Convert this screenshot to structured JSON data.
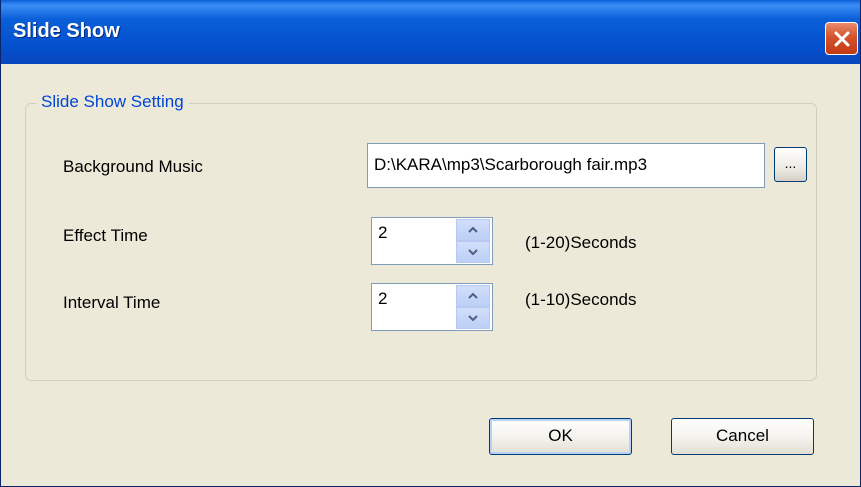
{
  "window": {
    "title": "Slide Show",
    "titlebar_color": "#0a5fd8",
    "close_icon": "close-icon"
  },
  "group": {
    "legend": "Slide Show Setting"
  },
  "background_music": {
    "label": "Background Music",
    "value": "D:\\KARA\\mp3\\Scarborough fair.mp3",
    "browse_label": "..."
  },
  "effect_time": {
    "label": "Effect Time",
    "value": "2",
    "range_text": "(1-20)Seconds"
  },
  "interval_time": {
    "label": "Interval Time",
    "value": "2",
    "range_text": "(1-10)Seconds"
  },
  "buttons": {
    "ok_label": "OK",
    "cancel_label": "Cancel"
  }
}
